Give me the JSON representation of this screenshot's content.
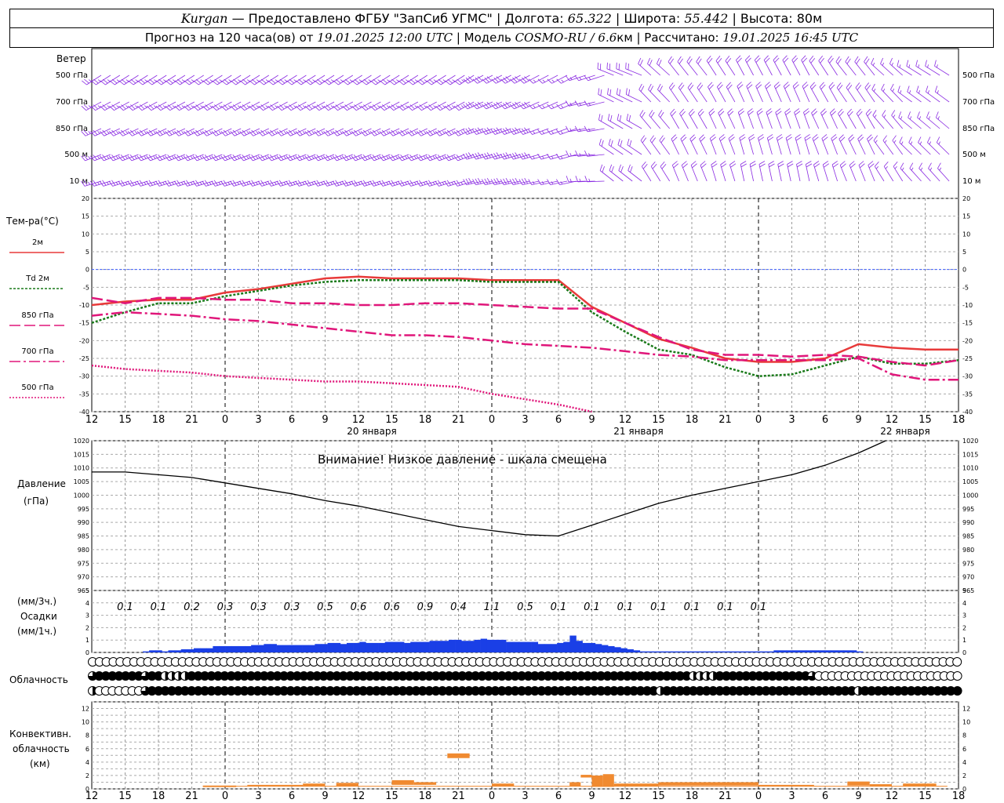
{
  "header": {
    "place": "Kurgan",
    "provider": " — Предоставлено ФГБУ \"ЗапСиб УГМС\" | Долгота: ",
    "lon": "65.322",
    "lat_label": " | Широта: ",
    "lat": "55.442",
    "alt_label": " | Высота: ",
    "alt": "80м",
    "forecast_label": "Прогноз на 120 часа(ов) от ",
    "forecast_date": "19.01.2025 12:00 UTC",
    "model_label": " | Модель ",
    "model": "COSMO-RU / 6.6",
    "model_unit": "км",
    "calc_label": " | Рассчитано: ",
    "calc_date": "19.01.2025 16:45 UTC"
  },
  "wind_panel": {
    "title": "Ветер",
    "levels": [
      "500 гПа",
      "700 гПа",
      "850 гПа",
      "500 м",
      "10  м"
    ],
    "color": "#8a2be2"
  },
  "temp_panel": {
    "title": "Тем-ра(°C)",
    "legend": [
      {
        "label": "2м",
        "color": "#e83a3a",
        "style": "solid"
      },
      {
        "label": "Td  2м",
        "color": "#1a7a1a",
        "style": "dotted"
      },
      {
        "label": "850 гПа",
        "color": "#e0167a",
        "style": "dash"
      },
      {
        "label": "700 гПа",
        "color": "#e0167a",
        "style": "dashdot"
      },
      {
        "label": "500 гПа",
        "color": "#e0167a",
        "style": "dot"
      }
    ]
  },
  "pressure_panel": {
    "title": "Давление",
    "unit": "(гПа)",
    "notice": "Внимание! Низкое давление - шкала смещена"
  },
  "precip_panel": {
    "unit3": "(мм/3ч.)",
    "title": "Осадки",
    "unit1": "(мм/1ч.)",
    "labels3h": [
      "0.1",
      "0.1",
      "0.2",
      "0.3",
      "0.3",
      "0.3",
      "0.5",
      "0.6",
      "0.6",
      "0.9",
      "0.4",
      "1.1",
      "0.5",
      "0.1",
      "0.1",
      "0.1",
      "0.1",
      "0.1",
      "0.1",
      "0.1"
    ]
  },
  "cloud_panel": {
    "title": "Облачность"
  },
  "conv_panel": {
    "title": "Конвективн.",
    "title2": "облачность",
    "unit": "(км)"
  },
  "time_axis": {
    "hour_ticks": [
      "12",
      "15",
      "18",
      "21",
      "0",
      "3",
      "6",
      "9",
      "12",
      "15",
      "18",
      "21",
      "0",
      "3",
      "6",
      "9",
      "12",
      "15",
      "18",
      "21",
      "0",
      "3",
      "6",
      "9",
      "12",
      "15",
      "18"
    ],
    "day_labels": [
      "20 января",
      "21 января",
      "22 января"
    ]
  },
  "chart_data": [
    {
      "type": "line",
      "title": "Тем-ра(°C)",
      "x_hours": [
        0,
        3,
        6,
        9,
        12,
        15,
        18,
        21,
        24,
        27,
        30,
        33,
        36,
        39,
        42,
        45,
        48,
        51,
        54,
        57,
        60,
        63,
        66,
        69,
        72,
        75,
        78
      ],
      "ylim": [
        -40,
        20
      ],
      "series": [
        {
          "name": "2м",
          "values": [
            -10,
            -9,
            -8.5,
            -8.5,
            -6.5,
            -5.5,
            -4,
            -2.5,
            -2,
            -2.5,
            -2.5,
            -2.5,
            -3,
            -3,
            -3,
            -10.5,
            -15,
            -19.5,
            -22,
            -25,
            -26,
            -26,
            -25,
            -21,
            -22,
            -22.5,
            -22.5
          ]
        },
        {
          "name": "Td 2м",
          "values": [
            -15,
            -12,
            -9.5,
            -9.5,
            -7.5,
            -6,
            -4.5,
            -3.5,
            -3,
            -3,
            -3,
            -3,
            -3.5,
            -3.5,
            -3.5,
            -12,
            -17.5,
            -22.5,
            -24,
            -27.5,
            -30,
            -29.5,
            -27,
            -24.5,
            -26.5,
            -26.5,
            -25.5
          ]
        },
        {
          "name": "850 гПа",
          "values": [
            -8,
            -9.5,
            -8,
            -8,
            -8.5,
            -8.5,
            -9.5,
            -9.5,
            -10,
            -10,
            -9.5,
            -9.5,
            -10,
            -10.5,
            -11,
            -11,
            -15,
            -19,
            -22.5,
            -24,
            -24,
            -24.5,
            -24,
            -24.5,
            -26,
            -27,
            -25.5
          ]
        },
        {
          "name": "700 гПа",
          "values": [
            -13,
            -12,
            -12.5,
            -13,
            -14,
            -14.5,
            -15.5,
            -16.5,
            -17.5,
            -18.5,
            -18.5,
            -19,
            -20,
            -21,
            -21.5,
            -22,
            -23,
            -24,
            -24.5,
            -25.5,
            -25.5,
            -25.5,
            -25.5,
            -25,
            -29.5,
            -31,
            -31
          ]
        },
        {
          "name": "500 гПа",
          "values": [
            -27,
            -28,
            -28.5,
            -29,
            -30,
            -30.5,
            -31,
            -31.5,
            -31.5,
            -32,
            -32.5,
            -33,
            -35,
            -36.5,
            -38,
            -41,
            null,
            null,
            null,
            null,
            null,
            null,
            null,
            null,
            null,
            null,
            null
          ]
        }
      ]
    },
    {
      "type": "line",
      "title": "Давление",
      "x_hours": [
        0,
        3,
        6,
        9,
        12,
        15,
        18,
        21,
        24,
        27,
        30,
        33,
        36,
        39,
        42,
        45,
        48,
        51,
        54,
        57,
        60,
        63,
        66,
        69,
        72,
        75,
        78
      ],
      "ylim": [
        965,
        1020
      ],
      "series": [
        {
          "name": "Давление",
          "values": [
            1008.5,
            1008.5,
            1007.5,
            1006.5,
            1004.5,
            1002.5,
            1000.5,
            998,
            996,
            993.5,
            991,
            988.5,
            987,
            985.5,
            985,
            989,
            993,
            997,
            1000,
            1002.5,
            1005,
            1007.5,
            1011,
            1015.5,
            1021,
            null,
            null
          ]
        }
      ]
    },
    {
      "type": "bar",
      "title": "Осадки",
      "ylim": [
        0,
        5
      ],
      "hourly_mm": [
        0,
        0,
        0,
        0,
        0,
        0,
        0,
        0,
        0.05,
        0.1,
        0.1,
        0.05,
        0.1,
        0.1,
        0.15,
        0.15,
        0.2,
        0.2,
        0.2,
        0.3,
        0.3,
        0.3,
        0.3,
        0.3,
        0.3,
        0.35,
        0.35,
        0.4,
        0.4,
        0.35,
        0.35,
        0.35,
        0.35,
        0.35,
        0.35,
        0.4,
        0.4,
        0.45,
        0.45,
        0.4,
        0.45,
        0.45,
        0.5,
        0.45,
        0.45,
        0.45,
        0.5,
        0.5,
        0.5,
        0.45,
        0.5,
        0.5,
        0.5,
        0.55,
        0.55,
        0.55,
        0.6,
        0.6,
        0.55,
        0.55,
        0.6,
        0.65,
        0.6,
        0.6,
        0.6,
        0.5,
        0.5,
        0.5,
        0.5,
        0.5,
        0.4,
        0.4,
        0.4,
        0.45,
        0.5,
        0.8,
        0.55,
        0.45,
        0.45,
        0.4,
        0.35,
        0.3,
        0.25,
        0.2,
        0.15,
        0.1,
        0.05,
        0.05,
        0.05,
        0.05,
        0.05,
        0.05,
        0.05,
        0.05,
        0.05,
        0.05,
        0.05,
        0.05,
        0.05,
        0.05,
        0.05,
        0.05,
        0.05,
        0.05,
        0.05,
        0.05,
        0.05,
        0.1,
        0.1,
        0.1,
        0.1,
        0.1,
        0.1,
        0.1,
        0.1,
        0.1,
        0.1,
        0.1,
        0.1,
        0.1,
        0.05,
        0,
        0,
        0,
        0,
        0,
        0,
        0,
        0,
        0,
        0,
        0,
        0,
        0,
        0,
        0
      ]
    },
    {
      "type": "bar",
      "title": "Конвективн. облачность (км)",
      "ylim": [
        0,
        13
      ],
      "segments": [
        {
          "from": 10,
          "to": 13,
          "base": 0.4,
          "top": 0.5
        },
        {
          "from": 14,
          "to": 19,
          "base": 0.4,
          "top": 0.6
        },
        {
          "from": 19,
          "to": 21,
          "base": 0.4,
          "top": 0.8
        },
        {
          "from": 22,
          "to": 24,
          "base": 0.4,
          "top": 0.9
        },
        {
          "from": 27,
          "to": 29,
          "base": 0.6,
          "top": 1.3
        },
        {
          "from": 29,
          "to": 31,
          "base": 0.6,
          "top": 1.0
        },
        {
          "from": 32,
          "to": 34,
          "base": 4.6,
          "top": 5.3
        },
        {
          "from": 36,
          "to": 38,
          "base": 0.4,
          "top": 0.8
        },
        {
          "from": 43,
          "to": 44,
          "base": 0.4,
          "top": 1.0
        },
        {
          "from": 44,
          "to": 45,
          "base": 1.7,
          "top": 2.1
        },
        {
          "from": 45,
          "to": 46,
          "base": 0.3,
          "top": 2.0
        },
        {
          "from": 46,
          "to": 47,
          "base": 0.3,
          "top": 2.2
        },
        {
          "from": 47,
          "to": 51,
          "base": 0.4,
          "top": 0.8
        },
        {
          "from": 51,
          "to": 54,
          "base": 0.5,
          "top": 1.0
        },
        {
          "from": 54,
          "to": 60,
          "base": 0.5,
          "top": 1.0
        },
        {
          "from": 60,
          "to": 65,
          "base": 0.4,
          "top": 0.6
        },
        {
          "from": 68,
          "to": 70,
          "base": 0.5,
          "top": 1.1
        },
        {
          "from": 70,
          "to": 72,
          "base": 0.4,
          "top": 0.7
        },
        {
          "from": 73,
          "to": 76,
          "base": 0.4,
          "top": 0.8
        }
      ]
    }
  ],
  "clouds": {
    "rows": [
      "OOOOOOOOOOOOOOOOOOOOOOOOOOOOOOOOOOOOOOOOOOOOOOOOOOOOOOOOOOOOOOOOOOOOOOOOOOOOOOOOOOOOOOOOOOOOOOOOOOOOOOOOOOOOOOOOOOOOOOOOOOOOOO",
      "MFFFFFFFMFFHHHHFFFFFFFFFFFFFFFFFFFFFFFFFFFFFFFFFFFFFFFFFFFFFFFFFFFFFFFFFFFFFFFFFFFFFFFFFFFFHHHHFFFFFFFFFFFFFFMOOOOOOOOOOOOOOOOOOOOOO",
      "HOOOOOOOMFFFFFFFFFFFFFFFFFFFFFFFFFFFFFFFFFFFFFFFFFFFFFFFFFFFFFFFFFFFFFFFFFFFFFFFFFFFFFHFFFFFFFFFFFFFFFFFFFFFFFFFFFFFHFFFFFFFFFFFFFFF"
    ]
  },
  "wind": {
    "dir_deg": [
      245,
      245,
      245,
      245,
      245,
      245,
      245,
      245,
      245,
      245,
      245,
      245,
      250,
      250,
      250,
      260,
      300,
      320,
      330,
      335,
      340,
      340,
      335,
      330,
      320,
      310,
      310
    ],
    "speed_ms": [
      15,
      15,
      15,
      15,
      15,
      15,
      15,
      15,
      15,
      15,
      15,
      15,
      14,
      13,
      12,
      10,
      9,
      9,
      8,
      8,
      8,
      8,
      8,
      9,
      10,
      10,
      10
    ]
  }
}
